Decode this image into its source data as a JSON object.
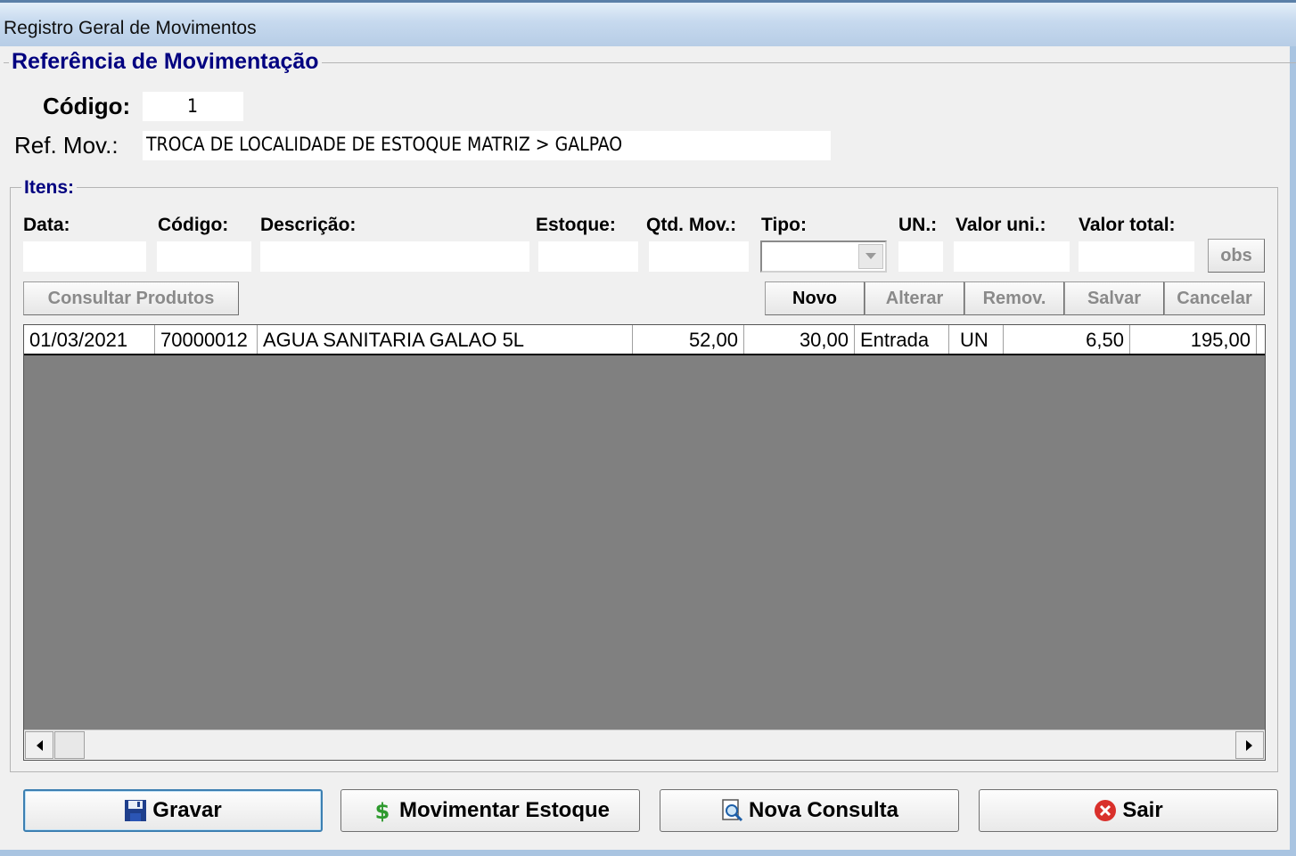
{
  "window": {
    "title": "Registro Geral de Movimentos"
  },
  "reference": {
    "legend": "Referência de Movimentação",
    "codigo_label": "Código:",
    "codigo_value": "1",
    "refmov_label": "Ref. Mov.:",
    "refmov_value": "TROCA DE LOCALIDADE DE ESTOQUE MATRIZ > GALPAO"
  },
  "itens": {
    "legend": "Itens:",
    "labels": {
      "data": "Data:",
      "codigo": "Código:",
      "descricao": "Descrição:",
      "estoque": "Estoque:",
      "qtd": "Qtd. Mov.:",
      "tipo": "Tipo:",
      "un": "UN.:",
      "valor_uni": "Valor uni.:",
      "valor_total": "Valor total:"
    },
    "obs_label": "obs",
    "consultar_label": "Consultar Produtos",
    "actions": {
      "novo": "Novo",
      "alterar": "Alterar",
      "remov": "Remov.",
      "salvar": "Salvar",
      "cancelar": "Cancelar"
    },
    "rows": [
      {
        "data": "01/03/2021",
        "codigo": "70000012",
        "descricao": "AGUA SANITARIA GALAO 5L",
        "estoque": "52,00",
        "qtd": "30,00",
        "tipo": "Entrada",
        "un": "UN",
        "valor_uni": "6,50",
        "valor_total": "195,00"
      }
    ]
  },
  "footer": {
    "gravar": "Gravar",
    "movimentar": "Movimentar Estoque",
    "nova_consulta": "Nova Consulta",
    "sair": "Sair"
  },
  "icons": {
    "gravar": "floppy-disk-icon",
    "movimentar": "green-dollar-icon",
    "nova_consulta": "document-search-icon",
    "sair": "red-x-circle-icon",
    "scroll_left": "arrow-left-icon",
    "scroll_right": "arrow-right-icon",
    "dropdown": "chevron-down-icon"
  }
}
